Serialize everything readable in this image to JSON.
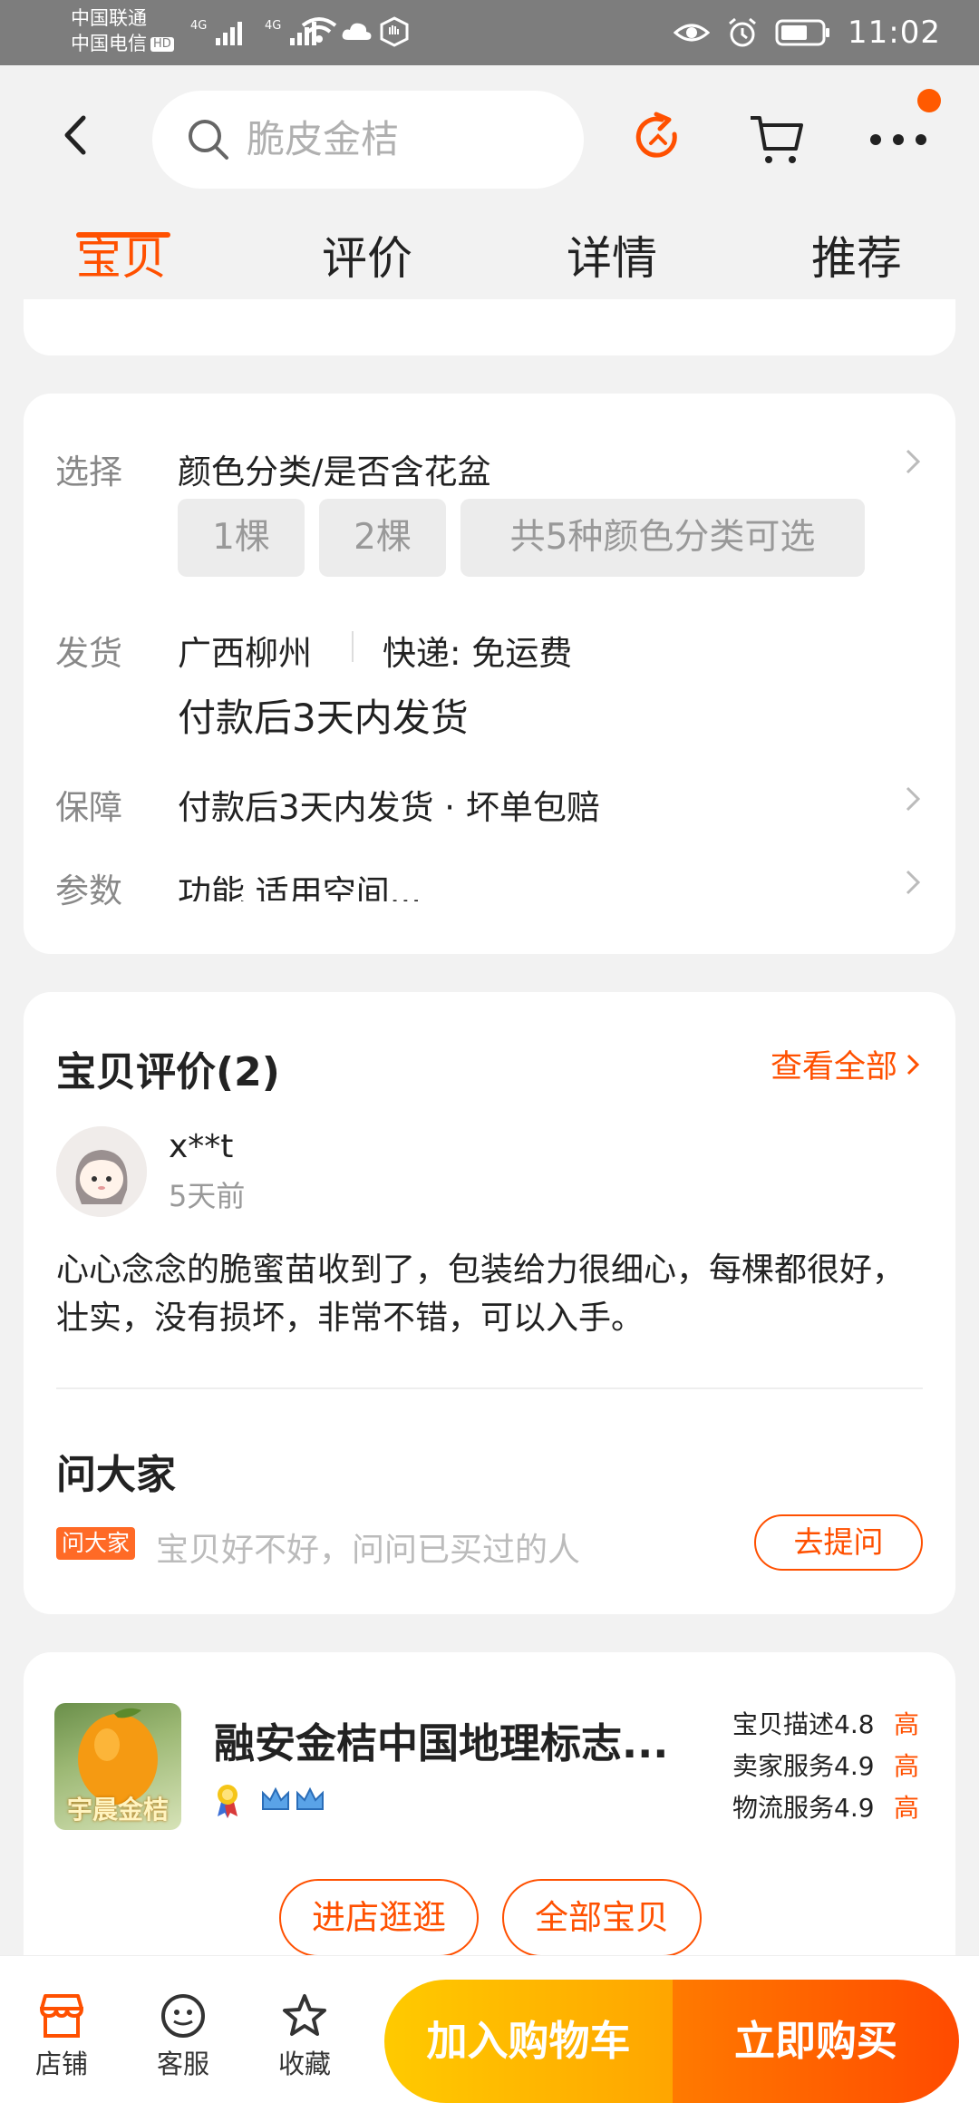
{
  "status_bar": {
    "carrier_1": "中国联通",
    "carrier_2": "中国电信",
    "hd": "HD",
    "net_1": "4G",
    "net_2": "4G",
    "time": "11:02"
  },
  "header": {
    "search_placeholder": "脆皮金桔",
    "tabs": [
      {
        "label": "宝贝",
        "active": true
      },
      {
        "label": "评价",
        "active": false
      },
      {
        "label": "详情",
        "active": false
      },
      {
        "label": "推荐",
        "active": false
      }
    ]
  },
  "spec": {
    "select_label": "选择",
    "select_value": "颜色分类/是否含花盆",
    "options": [
      "1棵",
      "2棵",
      "共5种颜色分类可选"
    ],
    "ship_label": "发货",
    "ship_origin": "广西柳州",
    "ship_method": "快递: 免运费",
    "ship_time": "付款后3天内发货",
    "guarantee_label": "保障",
    "guarantee_value": "付款后3天内发货 · 坏单包赔",
    "params_label": "参数",
    "params_value": "功能 适用空间..."
  },
  "review": {
    "title": "宝贝评价(2)",
    "see_all": "查看全部",
    "reviewer": "x**t",
    "time": "5天前",
    "text": "心心念念的脆蜜苗收到了，包装给力很细心，每棵都很好，壮实，没有损坏，非常不错，可以入手。",
    "ask_title": "问大家",
    "ask_badge": "问大家",
    "ask_hint": "宝贝好不好，问问已买过的人",
    "ask_button": "去提问"
  },
  "shop": {
    "logo_text": "宇晨金桔",
    "name": "融安金桔中国地理标志...",
    "scores": [
      {
        "label": "宝贝描述",
        "value": "4.8",
        "level": "高"
      },
      {
        "label": "卖家服务",
        "value": "4.9",
        "level": "高"
      },
      {
        "label": "物流服务",
        "value": "4.9",
        "level": "高"
      }
    ],
    "enter_shop": "进店逛逛",
    "all_items": "全部宝贝"
  },
  "bottom_bar": {
    "shop": "店铺",
    "service": "客服",
    "favorite": "收藏",
    "add_to_cart": "加入购物车",
    "buy_now": "立即购买"
  },
  "colors": {
    "accent": "#ff5000",
    "status_bar": "#7d7d7d",
    "cart_gradient": [
      "#ffca00",
      "#ffa500"
    ],
    "buy_gradient": [
      "#ff7a00",
      "#ff4a00"
    ]
  }
}
